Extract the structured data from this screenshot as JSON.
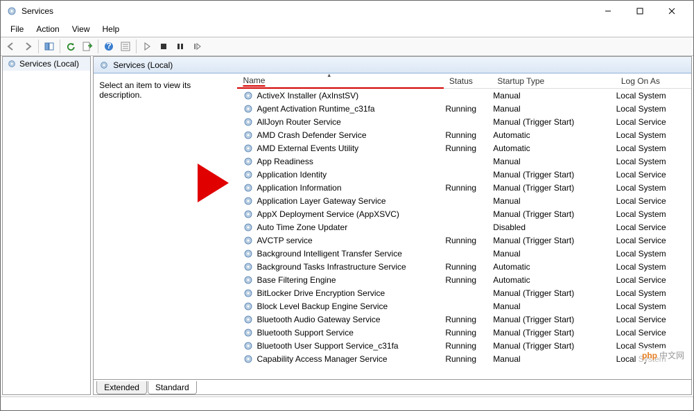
{
  "window": {
    "title": "Services"
  },
  "menu": {
    "file": "File",
    "action": "Action",
    "view": "View",
    "help": "Help"
  },
  "tree": {
    "root": "Services (Local)"
  },
  "panel": {
    "header": "Services (Local)",
    "desc_prompt": "Select an item to view its description.",
    "tabs": {
      "extended": "Extended",
      "standard": "Standard"
    }
  },
  "columns": {
    "name": "Name",
    "status": "Status",
    "startup": "Startup Type",
    "logon": "Log On As"
  },
  "rows": [
    {
      "name": "ActiveX Installer (AxInstSV)",
      "status": "",
      "startup": "Manual",
      "logon": "Local System"
    },
    {
      "name": "Agent Activation Runtime_c31fa",
      "status": "Running",
      "startup": "Manual",
      "logon": "Local System"
    },
    {
      "name": "AllJoyn Router Service",
      "status": "",
      "startup": "Manual (Trigger Start)",
      "logon": "Local Service"
    },
    {
      "name": "AMD Crash Defender Service",
      "status": "Running",
      "startup": "Automatic",
      "logon": "Local System"
    },
    {
      "name": "AMD External Events Utility",
      "status": "Running",
      "startup": "Automatic",
      "logon": "Local System"
    },
    {
      "name": "App Readiness",
      "status": "",
      "startup": "Manual",
      "logon": "Local System"
    },
    {
      "name": "Application Identity",
      "status": "",
      "startup": "Manual (Trigger Start)",
      "logon": "Local Service"
    },
    {
      "name": "Application Information",
      "status": "Running",
      "startup": "Manual (Trigger Start)",
      "logon": "Local System"
    },
    {
      "name": "Application Layer Gateway Service",
      "status": "",
      "startup": "Manual",
      "logon": "Local Service"
    },
    {
      "name": "AppX Deployment Service (AppXSVC)",
      "status": "",
      "startup": "Manual (Trigger Start)",
      "logon": "Local System"
    },
    {
      "name": "Auto Time Zone Updater",
      "status": "",
      "startup": "Disabled",
      "logon": "Local Service"
    },
    {
      "name": "AVCTP service",
      "status": "Running",
      "startup": "Manual (Trigger Start)",
      "logon": "Local Service"
    },
    {
      "name": "Background Intelligent Transfer Service",
      "status": "",
      "startup": "Manual",
      "logon": "Local System"
    },
    {
      "name": "Background Tasks Infrastructure Service",
      "status": "Running",
      "startup": "Automatic",
      "logon": "Local System"
    },
    {
      "name": "Base Filtering Engine",
      "status": "Running",
      "startup": "Automatic",
      "logon": "Local Service"
    },
    {
      "name": "BitLocker Drive Encryption Service",
      "status": "",
      "startup": "Manual (Trigger Start)",
      "logon": "Local System"
    },
    {
      "name": "Block Level Backup Engine Service",
      "status": "",
      "startup": "Manual",
      "logon": "Local System"
    },
    {
      "name": "Bluetooth Audio Gateway Service",
      "status": "Running",
      "startup": "Manual (Trigger Start)",
      "logon": "Local Service"
    },
    {
      "name": "Bluetooth Support Service",
      "status": "Running",
      "startup": "Manual (Trigger Start)",
      "logon": "Local Service"
    },
    {
      "name": "Bluetooth User Support Service_c31fa",
      "status": "Running",
      "startup": "Manual (Trigger Start)",
      "logon": "Local System"
    },
    {
      "name": "Capability Access Manager Service",
      "status": "Running",
      "startup": "Manual",
      "logon": "Local System"
    }
  ],
  "watermark": {
    "brand": "php",
    "text": "中文网"
  }
}
